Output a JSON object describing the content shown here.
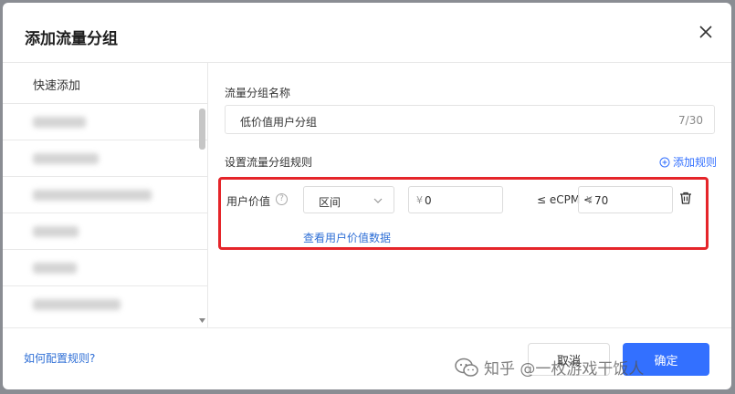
{
  "dialog": {
    "title": "添加流量分组"
  },
  "left": {
    "quick_add": "快速添加",
    "item_count": 6
  },
  "form": {
    "name_label": "流量分组名称",
    "name_value": "低价值用户分组",
    "name_count": "7/30",
    "rules_label": "设置流量分组规则",
    "add_rule": "添加规则"
  },
  "rule": {
    "label": "用户价值",
    "help": "?",
    "range": "区间",
    "currency": "¥",
    "min": "0",
    "middle": "≤ eCPM <",
    "max": "70",
    "view_data": "查看用户价值数据"
  },
  "footer": {
    "how_link": "如何配置规则?",
    "cancel": "取消",
    "confirm": "确定",
    "watermark": "知乎 @一枚游戏干饭人"
  },
  "colors": {
    "accent": "#3370ff",
    "highlight": "#e5252a"
  }
}
